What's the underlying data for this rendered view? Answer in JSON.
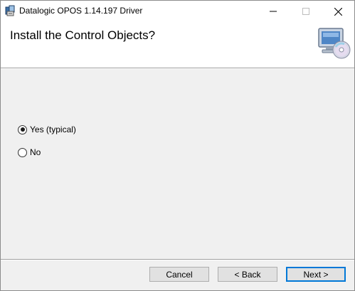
{
  "window": {
    "title": "Datalogic OPOS 1.14.197 Driver",
    "minimize_glyph": "—",
    "maximize_glyph": "☐",
    "close_glyph": "✕"
  },
  "header": {
    "title": "Install the Control Objects?",
    "graphic": "computer-cd-icon"
  },
  "options": [
    {
      "label": "Yes (typical)",
      "selected": true
    },
    {
      "label": "No",
      "selected": false
    }
  ],
  "buttons": {
    "cancel": "Cancel",
    "back": "< Back",
    "next": "Next >"
  },
  "colors": {
    "accent": "#0078d7",
    "panel": "#f0f0f0"
  }
}
